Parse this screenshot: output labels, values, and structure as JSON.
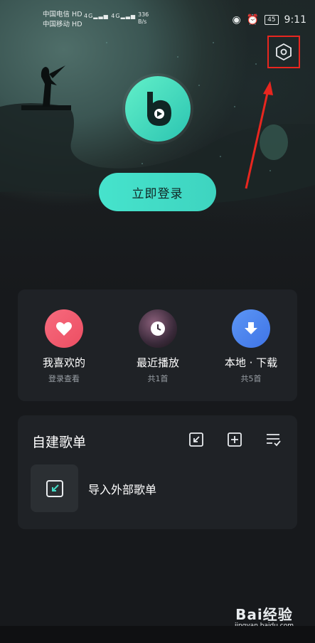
{
  "status_bar": {
    "carrier1": "中国电信",
    "carrier2": "中国移动",
    "hd": "HD",
    "signal": "4G",
    "speed_value": "336",
    "speed_unit": "B/s",
    "battery": "45",
    "time": "9:11"
  },
  "header": {
    "settings_icon": "settings-hexagon-icon",
    "login_button": "立即登录"
  },
  "quick_access": [
    {
      "label": "我喜欢的",
      "sub": "登录查看",
      "icon": "heart-icon",
      "color": "#f2566c"
    },
    {
      "label": "最近播放",
      "sub": "共1首",
      "icon": "recent-clock-icon",
      "color": "#3a2a3a"
    },
    {
      "label": "本地 · 下载",
      "sub": "共5首",
      "icon": "download-icon",
      "color": "#4d86f0"
    }
  ],
  "playlist": {
    "title": "自建歌单",
    "actions": [
      "import-icon",
      "add-icon",
      "manage-list-icon"
    ],
    "import_label": "导入外部歌单"
  },
  "watermark": {
    "main": "Bai经验",
    "sub": "jingyan.baidu.com"
  },
  "colors": {
    "accent": "#44dcc7",
    "annotation": "#e8261f",
    "card": "#1f2226",
    "background": "#17191c"
  }
}
